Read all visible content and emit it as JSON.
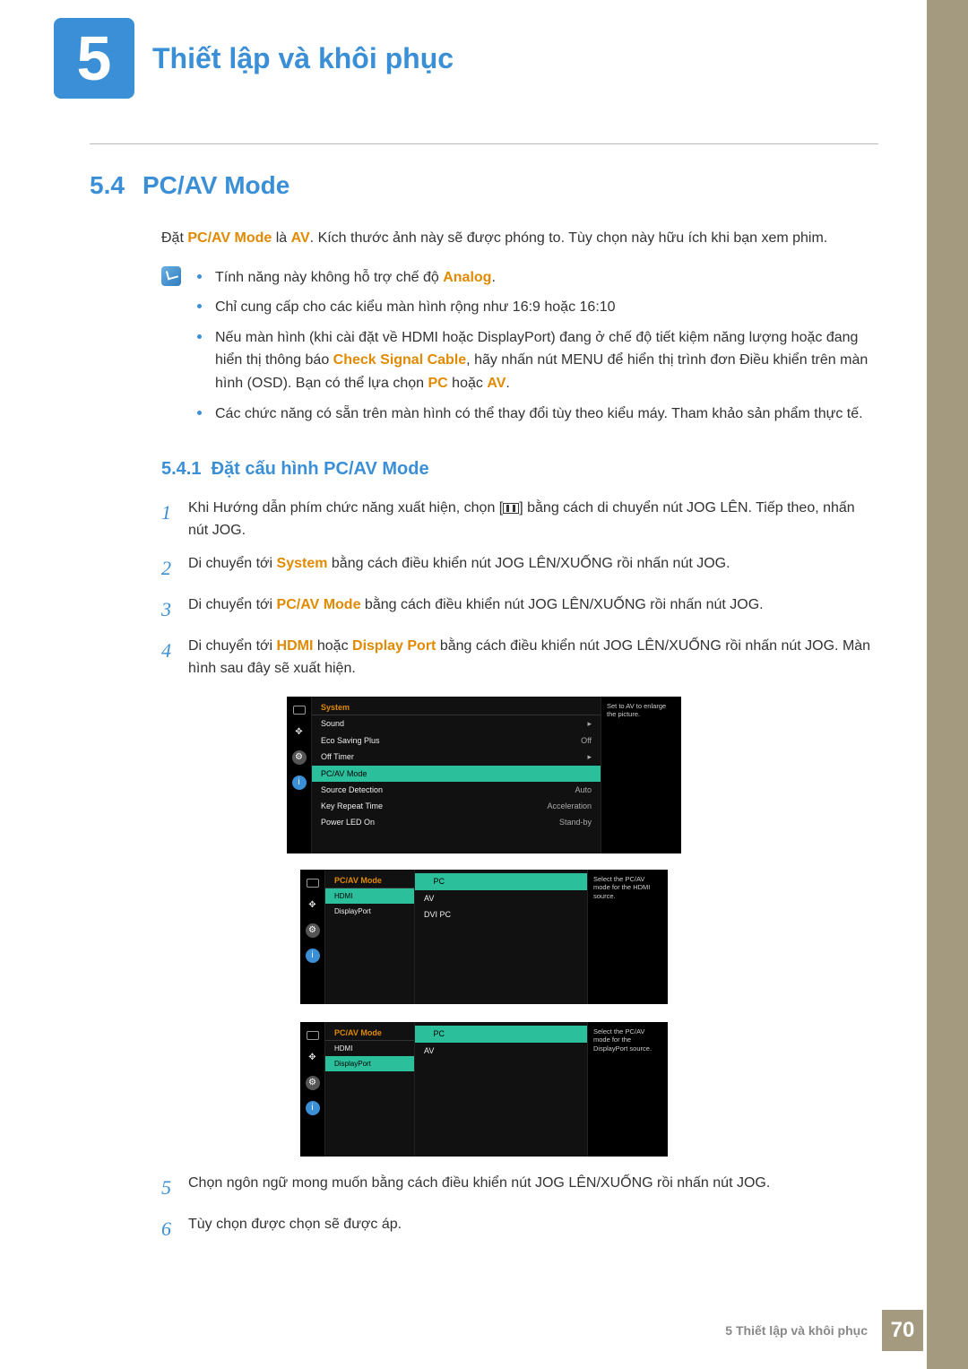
{
  "chapter": {
    "number": "5",
    "title": "Thiết lập và khôi phục"
  },
  "section": {
    "number": "5.4",
    "title": "PC/AV Mode"
  },
  "intro": {
    "pre": "Đặt ",
    "b1": "PC/AV Mode",
    "mid": " là ",
    "b2": "AV",
    "post": ". Kích thước ảnh này sẽ được phóng to. Tùy chọn này hữu ích khi bạn xem phim."
  },
  "notes": {
    "n1a": "Tính năng này không hỗ trợ chế độ ",
    "n1b": "Analog",
    "n1c": ".",
    "n2": "Chỉ cung cấp cho các kiểu màn hình rộng như 16:9 hoặc 16:10",
    "n3a": "Nếu màn hình (khi cài đặt về HDMI hoặc DisplayPort) đang ở chế độ tiết kiệm năng lượng hoặc đang hiển thị thông báo ",
    "n3b": "Check Signal Cable",
    "n3c": ", hãy nhấn nút MENU để hiển thị trình đơn Điều khiển trên màn hình (OSD). Bạn có thể lựa chọn ",
    "n3d": "PC",
    "n3e": " hoặc ",
    "n3f": "AV",
    "n3g": ".",
    "n4": "Các chức năng có sẵn trên màn hình có thể thay đổi tùy theo kiểu máy. Tham khảo sản phẩm thực tế."
  },
  "subsection": {
    "number": "5.4.1",
    "title": "Đặt cấu hình PC/AV Mode"
  },
  "steps": {
    "s1a": "Khi Hướng dẫn phím chức năng xuất hiện, chọn [",
    "s1b": "] bằng cách di chuyển nút JOG LÊN. Tiếp theo, nhấn nút JOG.",
    "s2a": "Di chuyển tới ",
    "s2b": "System",
    "s2c": " bằng cách điều khiển nút JOG LÊN/XUỐNG rồi nhấn nút JOG.",
    "s3a": "Di chuyển tới ",
    "s3b": "PC/AV Mode",
    "s3c": " bằng cách điều khiển nút JOG LÊN/XUỐNG rồi nhấn nút JOG.",
    "s4a": "Di chuyển tới ",
    "s4b": "HDMI",
    "s4c": " hoặc ",
    "s4d": "Display Port",
    "s4e": " bằng cách điều khiển nút JOG LÊN/XUỐNG rồi nhấn nút JOG. Màn hình sau đây sẽ xuất hiện.",
    "s5": "Chọn ngôn ngữ mong muốn bằng cách điều khiển nút JOG LÊN/XUỐNG rồi nhấn nút JOG.",
    "s6": "Tùy chọn được chọn sẽ được áp."
  },
  "osd_main": {
    "title": "System",
    "hint": "Set to AV to enlarge the picture.",
    "rows": [
      {
        "label": "Sound",
        "val": "▸"
      },
      {
        "label": "Eco Saving Plus",
        "val": "Off"
      },
      {
        "label": "Off Timer",
        "val": "▸"
      },
      {
        "label": "PC/AV Mode",
        "val": "",
        "sel": true
      },
      {
        "label": "Source Detection",
        "val": "Auto"
      },
      {
        "label": "Key Repeat Time",
        "val": "Acceleration"
      },
      {
        "label": "Power LED On",
        "val": "Stand-by"
      }
    ]
  },
  "osd_left": {
    "title": "PC/AV Mode",
    "hint": "Select the PC/AV mode for the HDMI source.",
    "col1": [
      {
        "label": "HDMI",
        "sel": true
      },
      {
        "label": "DisplayPort"
      }
    ],
    "col2": [
      {
        "label": "PC",
        "sel": true,
        "check": true
      },
      {
        "label": "AV"
      },
      {
        "label": "DVI PC"
      }
    ]
  },
  "osd_right": {
    "title": "PC/AV Mode",
    "hint": "Select the PC/AV mode for the DisplayPort source.",
    "col1": [
      {
        "label": "HDMI"
      },
      {
        "label": "DisplayPort",
        "sel": true
      }
    ],
    "col2": [
      {
        "label": "PC",
        "sel": true,
        "check": true
      },
      {
        "label": "AV"
      }
    ]
  },
  "footer": {
    "chapter_label": "5 Thiết lập và khôi phục",
    "page": "70"
  }
}
